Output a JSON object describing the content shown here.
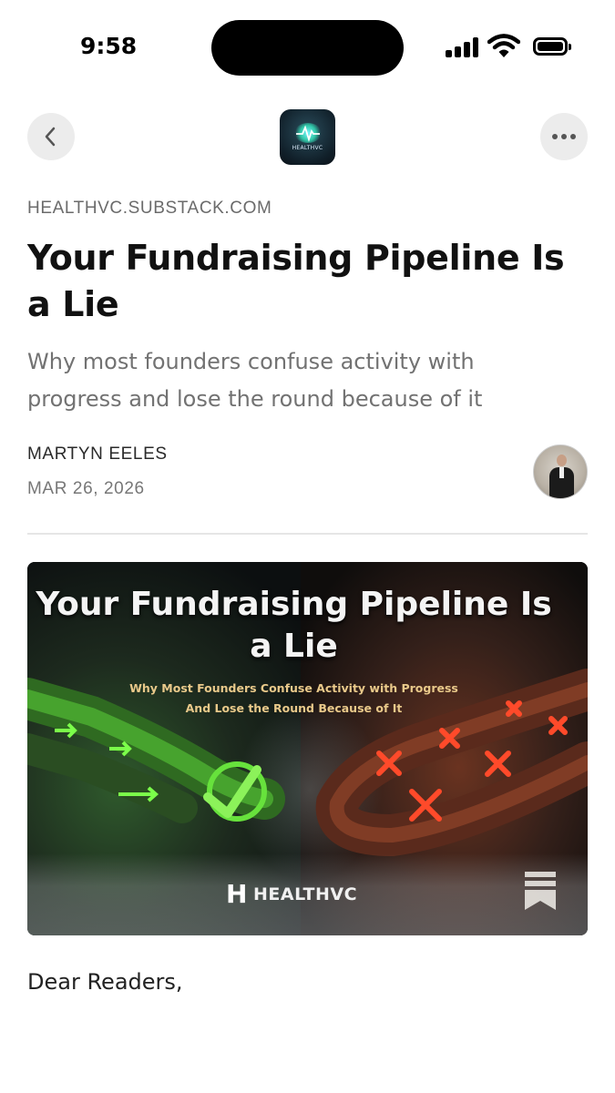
{
  "status_bar": {
    "time": "9:58",
    "icons": [
      "signal-icon",
      "wifi-icon",
      "battery-icon"
    ]
  },
  "nav": {
    "back_icon": "chevron-left-icon",
    "more_icon": "more-horizontal-icon",
    "logo_text": "HEALTHVC"
  },
  "article": {
    "publication": "HEALTHVC.SUBSTACK.COM",
    "title": "Your Fundraising Pipeline Is a Lie",
    "subtitle": "Why most founders confuse activity with progress and lose the round because of it",
    "author": "MARTYN EELES",
    "date": "MAR 26, 2026",
    "body_start": "Dear Readers,"
  },
  "hero": {
    "title": "Your Fundraising Pipeline Is a Lie",
    "tagline_1": "Why Most Founders Confuse Activity with Progress",
    "tagline_2": "And Lose the Round Because of It",
    "brand_mark": "H",
    "brand": "HEALTHVC",
    "save_icon": "bookmark-icon"
  },
  "colors": {
    "accent_green": "#63f03a",
    "accent_red": "#ff4a2a",
    "muted_text": "#727272"
  }
}
